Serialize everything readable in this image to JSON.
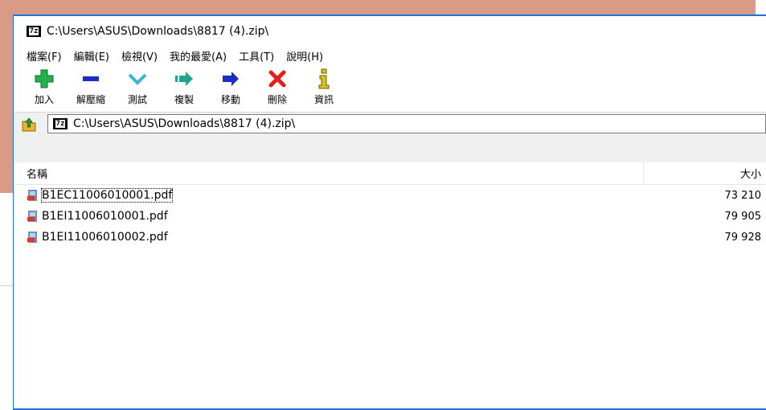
{
  "window": {
    "title": "C:\\Users\\ASUS\\Downloads\\8817 (4).zip\\",
    "app_icon_text": "7z"
  },
  "menu": [
    "檔案(F)",
    "編輯(E)",
    "檢視(V)",
    "我的最愛(A)",
    "工具(T)",
    "說明(H)"
  ],
  "toolbar": [
    {
      "label": "加入",
      "icon": "plus-icon",
      "color": "#22b14c"
    },
    {
      "label": "解壓縮",
      "icon": "minus-icon",
      "color": "#1a2fbf"
    },
    {
      "label": "測試",
      "icon": "check-chevron-icon",
      "color": "#3bb4d8"
    },
    {
      "label": "複製",
      "icon": "copy-arrow-icon",
      "color": "#19a88c"
    },
    {
      "label": "移動",
      "icon": "move-arrow-icon",
      "color": "#1a2fbf"
    },
    {
      "label": "刪除",
      "icon": "delete-x-icon",
      "color": "#e0201b"
    },
    {
      "label": "資訊",
      "icon": "info-icon",
      "color": "#d7c21a"
    }
  ],
  "address": {
    "path": "C:\\Users\\ASUS\\Downloads\\8817 (4).zip\\"
  },
  "columns": {
    "name": "名稱",
    "size": "大小"
  },
  "files": [
    {
      "name": "B1EC11006010001.pdf",
      "size": "73 210",
      "selected": true
    },
    {
      "name": "B1EI11006010001.pdf",
      "size": "79 905",
      "selected": false
    },
    {
      "name": "B1EI11006010002.pdf",
      "size": "79 928",
      "selected": false
    }
  ]
}
